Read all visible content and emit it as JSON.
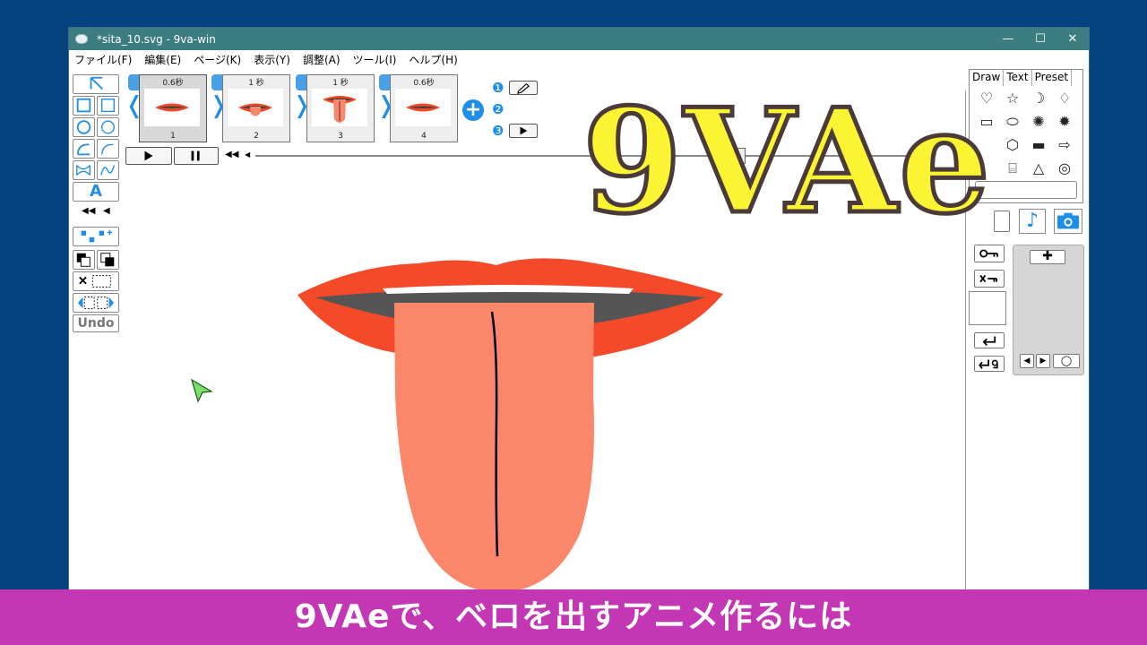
{
  "window": {
    "title": "*sita_10.svg  - 9va-win",
    "minimize": "—",
    "maximize": "☐",
    "close": "✕"
  },
  "menu": [
    "ファイル(F)",
    "編集(E)",
    "ページ(K)",
    "表示(Y)",
    "調整(A)",
    "ツール(I)",
    "ヘルプ(H)"
  ],
  "frames": [
    {
      "duration": "0.6秒",
      "number": "1"
    },
    {
      "duration": "1 秒",
      "number": "2"
    },
    {
      "duration": "1 秒",
      "number": "3"
    },
    {
      "duration": "0.6秒",
      "number": "4"
    }
  ],
  "toolbar": {
    "text_tool": "A",
    "undo": "Undo",
    "rewind": "◀◀",
    "back": "◀"
  },
  "steps": [
    "❶",
    "❷",
    "❸"
  ],
  "right_panel": {
    "tabs": [
      "Draw",
      "Text",
      "Preset"
    ]
  },
  "logo": "9VAe",
  "caption": "9VAeで、ベロを出すアニメ作るには",
  "colors": {
    "lips": "#f44a2a",
    "tongue": "#fb876a",
    "mouth": "#555555",
    "accent": "#1e8ee6",
    "caption_bg": "#c336b4",
    "logo": "#fbf432"
  }
}
